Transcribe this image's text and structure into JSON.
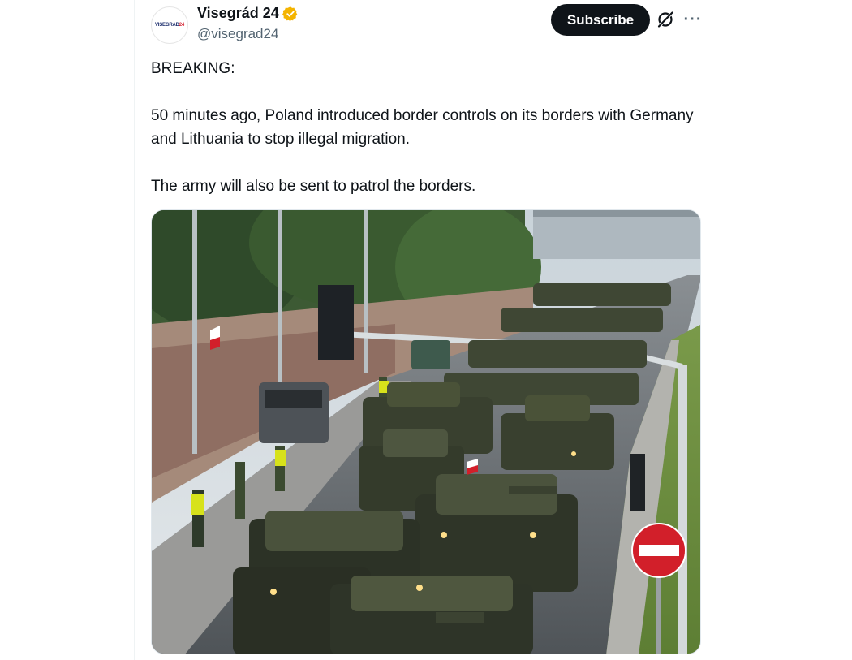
{
  "post": {
    "author": {
      "display_name": "Visegrád 24",
      "handle": "@visegrad24",
      "avatar_text_main": "VISEGRAD",
      "avatar_text_accent": "24",
      "verified": true,
      "verified_color": "#f4b400"
    },
    "subscribe_label": "Subscribe",
    "icons": {
      "grok": "grok-icon",
      "more": "more-icon",
      "verified": "verified-badge-icon"
    },
    "paragraphs": [
      "BREAKING:",
      "50 minutes ago, Poland introduced border controls on its borders with Germany and Lithuania to stop illegal migration.",
      "The army will also be sent to patrol the borders."
    ],
    "media": {
      "road_sign": "no-entry-sign"
    }
  },
  "colors": {
    "subscribe_bg": "#0f1419",
    "text": "#0f1419",
    "muted": "#536471",
    "sign_red": "#d21f2a"
  }
}
